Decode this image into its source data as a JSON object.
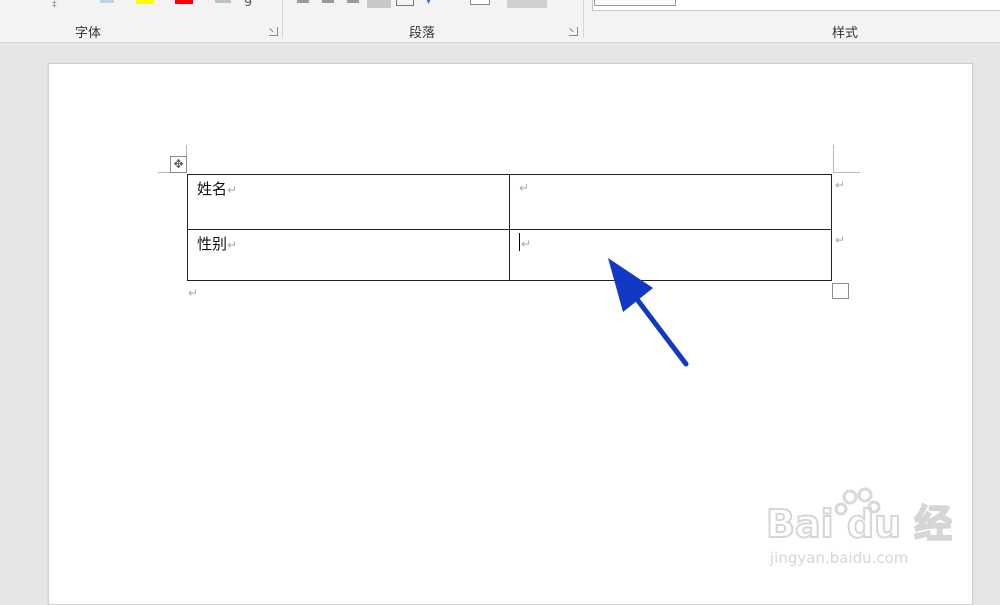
{
  "ribbon": {
    "groups": [
      {
        "label": "字体",
        "has_launcher": true
      },
      {
        "label": "段落",
        "has_launcher": true
      },
      {
        "label": "样式",
        "has_launcher": false
      }
    ],
    "colors": {
      "highlight": "#ffff00",
      "font_color": "#ff0000",
      "active_button": "#c8c8c8"
    }
  },
  "document": {
    "table": {
      "rows": [
        {
          "cells": [
            "姓名",
            ""
          ]
        },
        {
          "cells": [
            "性别",
            ""
          ]
        }
      ]
    },
    "paragraph_mark": "↵",
    "cursor_cell": "row 2, column 2"
  },
  "annotation": {
    "arrow_color": "#1239c4"
  },
  "watermark": {
    "logo": "Bai du 经验",
    "url": "jingyan.baidu.com"
  }
}
